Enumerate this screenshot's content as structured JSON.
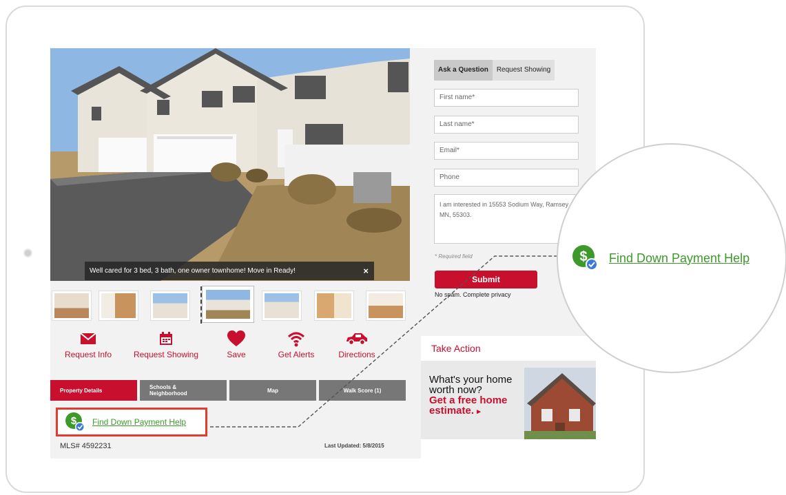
{
  "caption": {
    "text": "Well cared for 3 bed, 3 bath, one owner townhome! Move in Ready!",
    "close": "×"
  },
  "actions": [
    {
      "label": "Request Info",
      "icon": "envelope-icon"
    },
    {
      "label": "Request Showing",
      "icon": "calendar-icon"
    },
    {
      "label": "Save",
      "icon": "heart-icon"
    },
    {
      "label": "Get Alerts",
      "icon": "wifi-icon"
    },
    {
      "label": "Directions",
      "icon": "car-icon"
    }
  ],
  "tabs": [
    "Property Details",
    "Schools & Neighborhood",
    "Map",
    "Walk Score (1)"
  ],
  "down_payment": {
    "label": "Find Down Payment Help",
    "icon": "dollar-check-icon"
  },
  "mls": "MLS# 4592231",
  "last_updated": "Last Updated: 5/8/2015",
  "form": {
    "tabs": [
      "Ask a Question",
      "Request Showing"
    ],
    "first_name_placeholder": "First name*",
    "last_name_placeholder": "Last name*",
    "email_placeholder": "Email*",
    "phone_placeholder": "Phone",
    "message": "I am interested in 15553 Sodium Way, Ramsey MN, 55303.",
    "required_note": "* Required field",
    "submit": "Submit",
    "privacy": "No spam. Complete privacy"
  },
  "take_action": {
    "title": "Take Action",
    "ad_line1": "What's your home worth now?",
    "ad_line2": "Get a free home estimate.",
    "ad_arrow": "▸"
  },
  "zoom": {
    "label": "Find Down Payment Help"
  },
  "colors": {
    "brand_red": "#c8102e",
    "link_green": "#3d9a2a",
    "highlight_border": "#e33b2e"
  }
}
